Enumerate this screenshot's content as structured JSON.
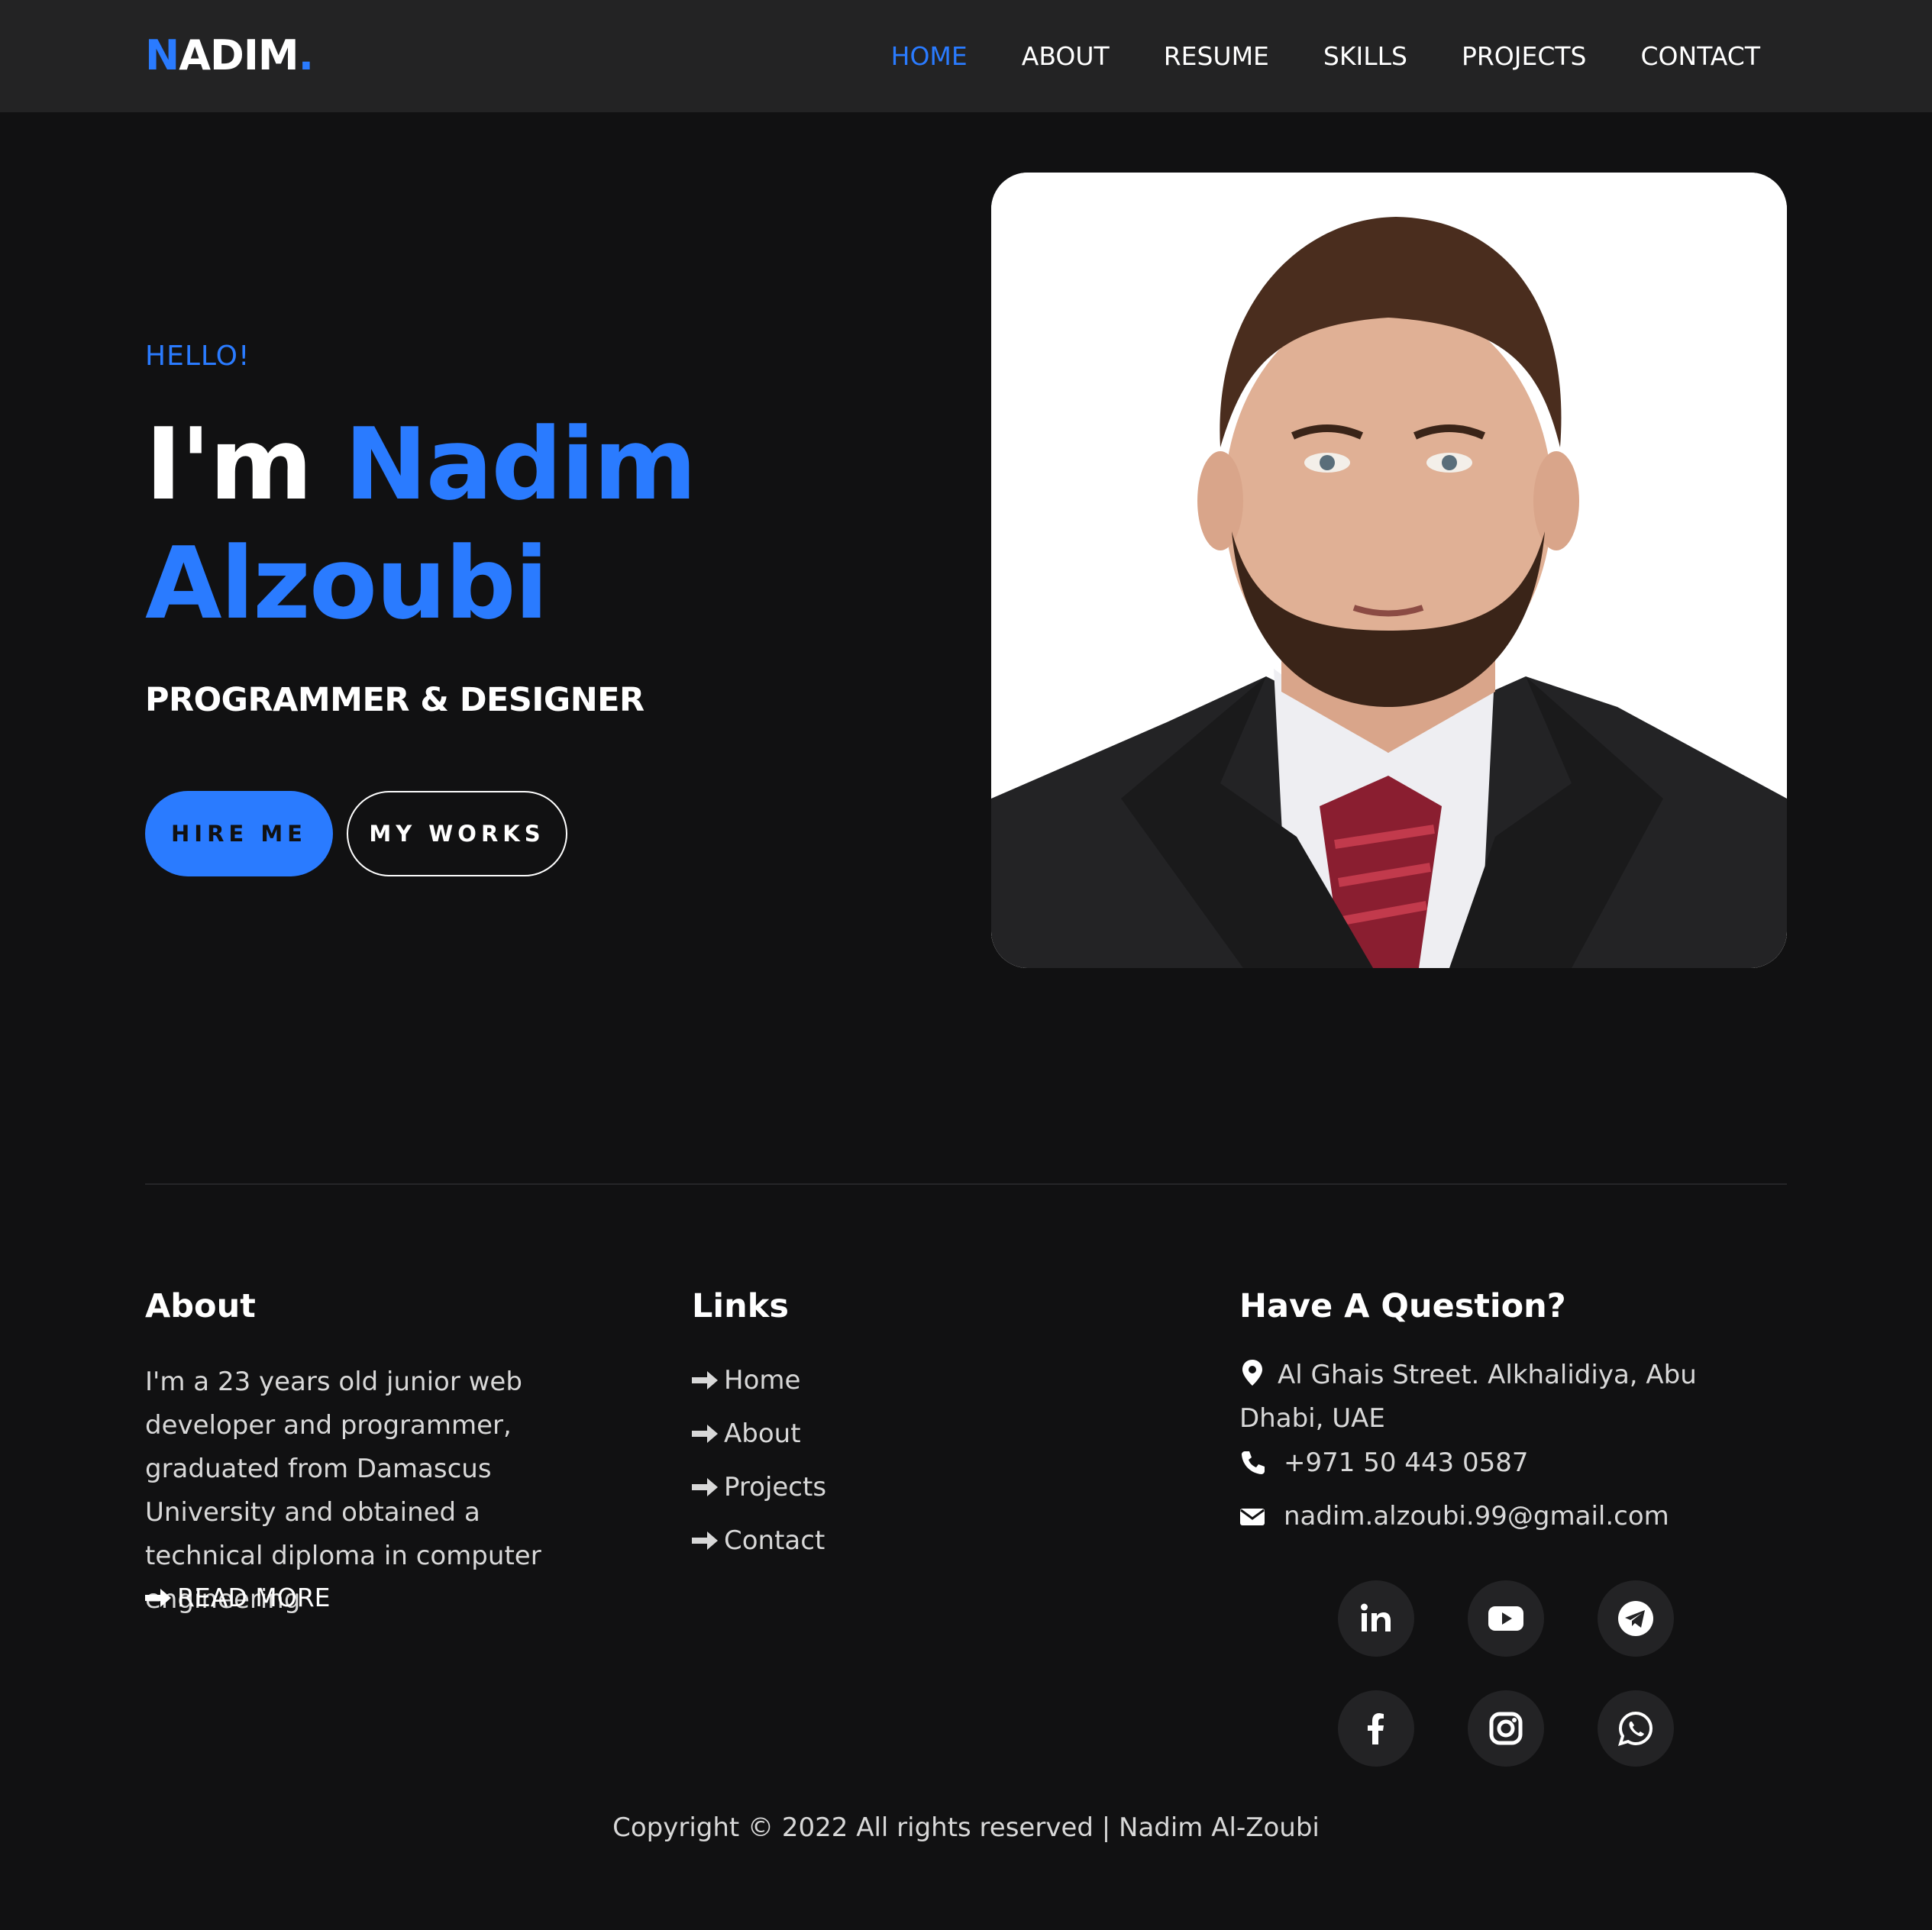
{
  "nav": {
    "logo_first": "N",
    "logo_rest": "ADIM",
    "logo_dot": ".",
    "links": [
      "HOME",
      "ABOUT",
      "RESUME",
      "SKILLS",
      "PROJECTS",
      "CONTACT"
    ],
    "active": "HOME"
  },
  "hero": {
    "greeting": "HELLO!",
    "title_prefix": "I'm",
    "title_name_line1": "Nadim",
    "title_name_line2": "Alzoubi",
    "subtitle": "PROGRAMMER & DESIGNER",
    "hire_button": "HIRE ME",
    "works_button": "MY WORKS"
  },
  "footer": {
    "about": {
      "title": "About",
      "text": "I'm a 23 years old junior web developer and programmer, graduated from Damascus University and obtained a technical diploma in computer engineering",
      "read_more": "READ MORE"
    },
    "links": {
      "title": "Links",
      "items": [
        "Home",
        "About",
        "Projects",
        "Contact"
      ]
    },
    "contact": {
      "title": "Have A Question?",
      "address": "Al Ghais Street. Alkhalidiya, Abu Dhabi, UAE",
      "phone": "+971 50 443 0587",
      "email": "nadim.alzoubi.99@gmail.com"
    },
    "social_icons": [
      "linkedin-icon",
      "youtube-icon",
      "telegram-icon",
      "facebook-icon",
      "instagram-icon",
      "whatsapp-icon"
    ],
    "copyright": "Copyright © 2022 All rights reserved | Nadim Al-Zoubi"
  },
  "colors": {
    "accent": "#2a7bff",
    "background": "#111112",
    "navbar": "#232324"
  }
}
